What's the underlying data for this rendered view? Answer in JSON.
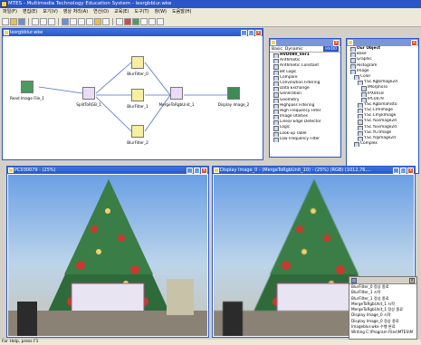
{
  "app": {
    "title": "MTES - Multimedia Technology Education System - lesrgbblur.wke"
  },
  "menu": [
    "파일(F)",
    "편집(E)",
    "보기(V)",
    "영상 처리(A)",
    "연산(O)",
    "교육(E)",
    "도구(T)",
    "창(W)",
    "도움말(H)"
  ],
  "graph_window": {
    "title": "lesrgbblur.wke",
    "nodes": {
      "read": "Read Image File_1",
      "split": "SplitToRGB_1",
      "blur0": "BlurFilter_0",
      "blur1": "BlurFilter_1",
      "blur2": "BlurFilter_2",
      "merge": "MergeToRgbUnit_1",
      "display": "Display Image_2"
    }
  },
  "library_window": {
    "tabs": [
      "Basic",
      "Dynamic"
    ],
    "badge": "HVD0",
    "root": "HVD080_Ver1",
    "items": [
      "Arithmetic",
      "Arithmetic Constant",
      "Bit Logic",
      "Compare",
      "Convolution Filtering",
      "Data Exchange",
      "Generation",
      "Geometry",
      "Highpass Filtering",
      "High Frequency Filter",
      "Image Utilities",
      "Linear Edge Detector",
      "Logic",
      "Look-up Table",
      "Low Frequency Filter"
    ]
  },
  "object_window": {
    "root": "Our Object",
    "items": [
      "Base",
      "Graphic",
      "Histogram",
      "Image",
      "Color",
      "Y.Sc.Rgbimage2d",
      "IMorphoTo",
      "IPX0018",
      "IPC0079",
      "Y.Sc.Rgbimahisto",
      "Y.Sc.CrmImage",
      "Y.Sc.CmykImage",
      "Y.Sc.Yuvimage2d",
      "Y.Sc.Yuvimage2d",
      "Y.Sc.YCrImage",
      "Y.Sc.Yiqimage2d",
      "Complex"
    ]
  },
  "image_window_left": {
    "title": "PC030079 - (25%)"
  },
  "image_window_right": {
    "title": "Display Image_0 - (MergeToRgbUnit_10) - (25%) (RGB) (1012,76,..."
  },
  "log_window": {
    "lines": [
      "BlurFilter_0 정상 종료",
      "BlurFilter_1 시작",
      "BlurFilter_1 정상 종료",
      "MergeToRgbUnit_1 시작",
      "MergeToRgbUnit_1 정상 종료",
      "Display Image_0 시작",
      "Display Image_0 정상 종료",
      "Imageblur.wke 수행 완료",
      "Writing C:\\Program Files\\MTES\\M"
    ]
  },
  "status": {
    "text": "For Help, press F1"
  }
}
